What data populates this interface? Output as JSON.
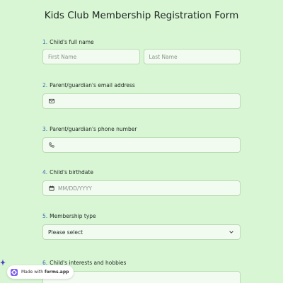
{
  "form": {
    "title": "Kids Club Membership Registration Form",
    "questions": [
      {
        "number": "1.",
        "label": "Child's full name",
        "placeholders": [
          "First Name",
          "Last Name"
        ]
      },
      {
        "number": "2.",
        "label": "Parent/guardian's email address",
        "value": "",
        "icon": "mail-icon"
      },
      {
        "number": "3.",
        "label": "Parent/guardian's phone number",
        "value": "",
        "icon": "phone-icon"
      },
      {
        "number": "4.",
        "label": "Child's birthdate",
        "placeholder": "MM/DD/YYYY",
        "icon": "calendar-icon"
      },
      {
        "number": "5.",
        "label": "Membership type",
        "selected": "Please select",
        "icon": "chevron-down-icon"
      },
      {
        "number": "6.",
        "label": "Child's interests and hobbies"
      }
    ]
  },
  "badge": {
    "prefix": "Made with",
    "brand": "forms.app"
  },
  "colors": {
    "background": "#d8f5d4",
    "field": "#f1fbef",
    "field_border": "#b9dcb3",
    "number_accent": "#3a6db5"
  }
}
